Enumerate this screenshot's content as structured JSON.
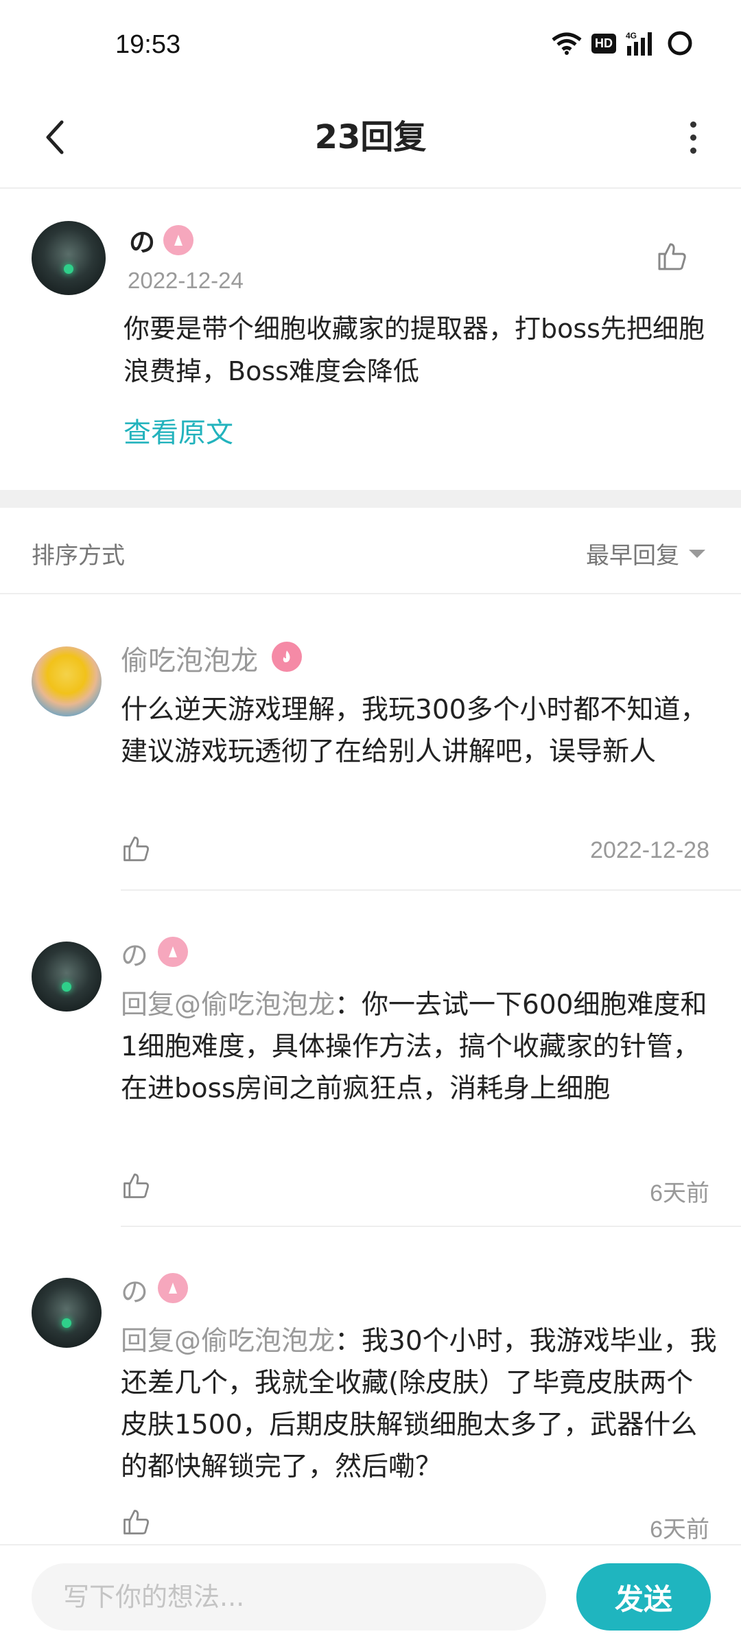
{
  "status_bar": {
    "time": "19:53",
    "hd_label": "HD",
    "network_label": "4G"
  },
  "header": {
    "title": "23回复"
  },
  "main_post": {
    "author": "の",
    "date": "2022-12-24",
    "content": "你要是带个细胞收藏家的提取器，打boss先把细胞浪费掉，Boss难度会降低",
    "view_original": "查看原文"
  },
  "sort": {
    "label": "排序方式",
    "value": "最早回复"
  },
  "replies": [
    {
      "author": "偷吃泡泡龙",
      "mention": "",
      "text": "什么逆天游戏理解，我玩300多个小时都不知道，建议游戏玩透彻了在给别人讲解吧，误导新人",
      "date": "2022-12-28"
    },
    {
      "author": "の",
      "mention": "回复@偷吃泡泡龙",
      "text": "：你一去试一下600细胞难度和1细胞难度，具体操作方法，搞个收藏家的针管，在进boss房间之前疯狂点，消耗身上细胞",
      "date": "6天前"
    },
    {
      "author": "の",
      "mention": "回复@偷吃泡泡龙",
      "text": "：我30个小时，我游戏毕业，我还差几个，我就全收藏(除皮肤）了毕竟皮肤两个皮肤1500，后期皮肤解锁细胞太多了，武器什么的都快解锁完了，然后嘞？",
      "date": "6天前"
    }
  ],
  "composer": {
    "placeholder": "写下你的想法...",
    "send_label": "发送"
  },
  "colors": {
    "accent": "#1fb5bf",
    "link": "#23b3bd",
    "badge_pink": "#f6a7bd"
  }
}
